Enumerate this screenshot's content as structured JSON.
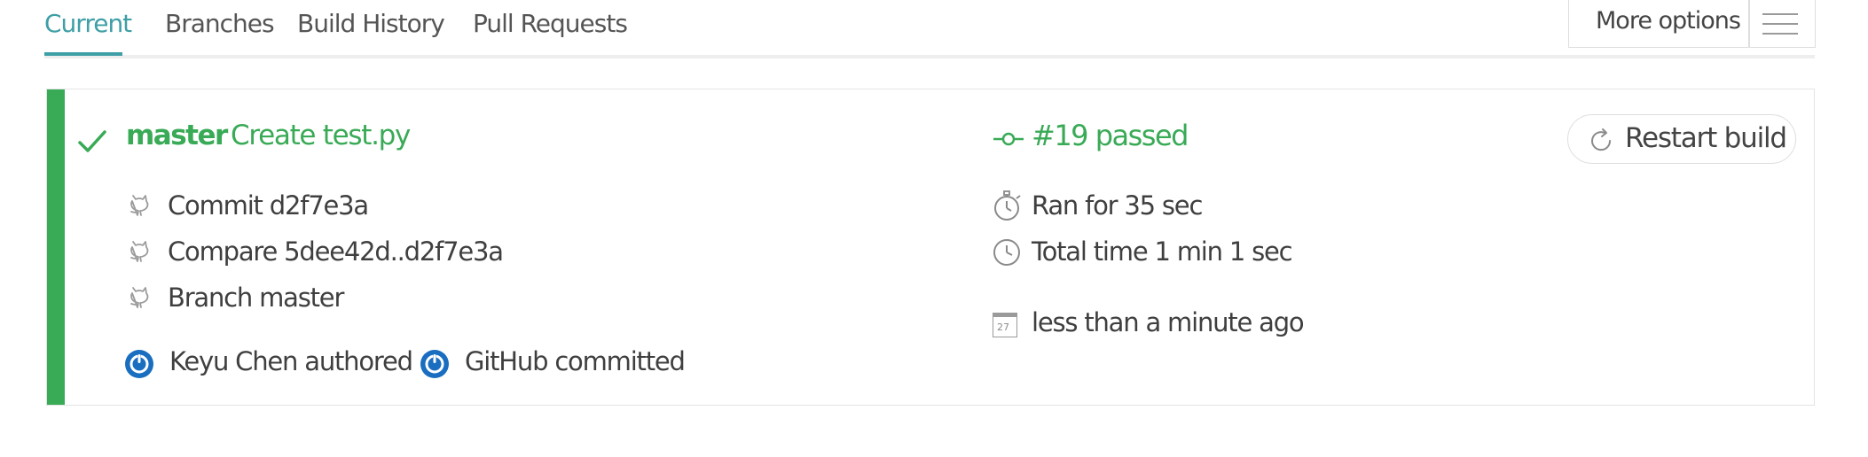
{
  "tabs": {
    "items": [
      {
        "label": "Current",
        "active": true
      },
      {
        "label": "Branches",
        "active": false
      },
      {
        "label": "Build History",
        "active": false
      },
      {
        "label": "Pull Requests",
        "active": false
      }
    ],
    "accent_color": "#3e9fa6"
  },
  "more_options": {
    "label": "More options",
    "icon": "hamburger-menu-icon"
  },
  "build": {
    "status_color": "#39aa56",
    "status_icon": "checkmark-icon",
    "branch": "master",
    "message": "Create test.py",
    "number_status": "#19 passed",
    "commit": "Commit d2f7e3a",
    "compare": "Compare 5dee42d..d2f7e3a",
    "branch_link": "Branch master",
    "author": "Keyu Chen authored",
    "committer": "GitHub committed",
    "duration": "Ran for 35 sec",
    "total_time": "Total time 1 min 1 sec",
    "finished": "less than a minute ago",
    "calendar_day": "27",
    "restart_label": "Restart build"
  }
}
